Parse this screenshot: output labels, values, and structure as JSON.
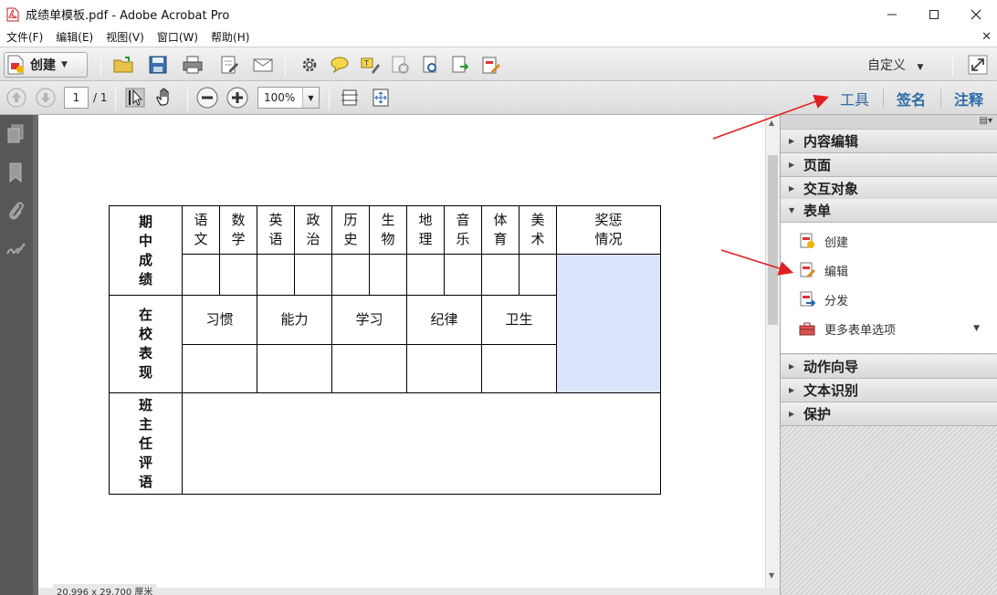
{
  "window": {
    "title": "成绩单模板.pdf - Adobe Acrobat Pro",
    "app_icon": "acrobat-pdf-icon"
  },
  "menu": {
    "items": [
      "文件(F)",
      "编辑(E)",
      "视图(V)",
      "窗口(W)",
      "帮助(H)"
    ]
  },
  "toolbar": {
    "create_label": "创建",
    "customize_label": "自定义"
  },
  "navigation": {
    "current_page": "1",
    "total_pages": "/ 1",
    "zoom": "100%"
  },
  "pane_tabs": {
    "tools": "工具",
    "sign": "签名",
    "comment": "注释"
  },
  "grade_table": {
    "row1_label": [
      "期",
      "中",
      "成",
      "绩"
    ],
    "subjects": [
      [
        "语",
        "文"
      ],
      [
        "数",
        "学"
      ],
      [
        "英",
        "语"
      ],
      [
        "政",
        "治"
      ],
      [
        "历",
        "史"
      ],
      [
        "生",
        "物"
      ],
      [
        "地",
        "理"
      ],
      [
        "音",
        "乐"
      ],
      [
        "体",
        "育"
      ],
      [
        "美",
        "术"
      ]
    ],
    "reward_header": [
      "奖惩",
      "情况"
    ],
    "row2_label": [
      "在",
      "校",
      "表",
      "现"
    ],
    "behaviors": [
      "习惯",
      "能力",
      "学习",
      "纪律",
      "卫生"
    ],
    "row3_label": [
      "班",
      "主",
      "任",
      "评",
      "语"
    ]
  },
  "right_panel": {
    "sections": [
      "内容编辑",
      "页面",
      "交互对象",
      "表单",
      "动作向导",
      "文本识别",
      "保护"
    ],
    "form_items": [
      "创建",
      "编辑",
      "分发",
      "更多表单选项"
    ]
  },
  "status": {
    "page_size": "20.996 x 29.700 厘米"
  },
  "colors": {
    "accent_blue": "#2e6aa8",
    "fill_blue": "#dce4fb",
    "arrow_red": "#e02020",
    "nav_dark": "#575757"
  }
}
